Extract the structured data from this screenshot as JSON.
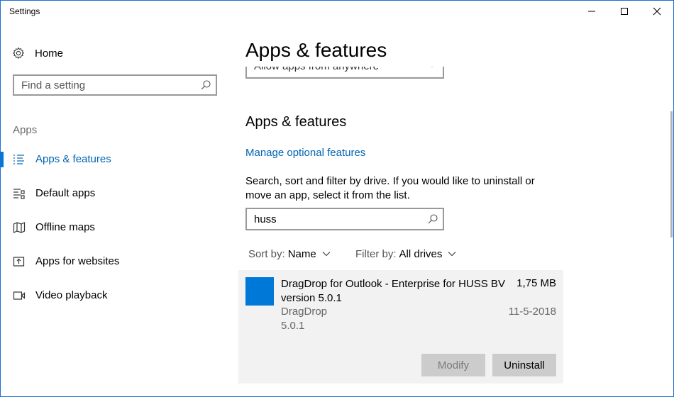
{
  "window": {
    "title": "Settings"
  },
  "sidebar": {
    "home_label": "Home",
    "search_placeholder": "Find a setting",
    "section_label": "Apps",
    "items": [
      {
        "label": "Apps & features",
        "icon": "list-icon",
        "active": true
      },
      {
        "label": "Default apps",
        "icon": "default-apps-icon",
        "active": false
      },
      {
        "label": "Offline maps",
        "icon": "map-icon",
        "active": false
      },
      {
        "label": "Apps for websites",
        "icon": "open-in-app-icon",
        "active": false
      },
      {
        "label": "Video playback",
        "icon": "video-icon",
        "active": false
      }
    ]
  },
  "main": {
    "page_title": "Apps & features",
    "install_source_value": "Allow apps from anywhere",
    "section_title": "Apps & features",
    "manage_link": "Manage optional features",
    "description": "Search, sort and filter by drive. If you would like to uninstall or move an app, select it from the list.",
    "search_value": "huss",
    "sort_key": "Sort by:",
    "sort_value": "Name",
    "filter_key": "Filter by:",
    "filter_value": "All drives",
    "app": {
      "name": "DragDrop for Outlook - Enterprise for HUSS BV version 5.0.1",
      "size": "1,75 MB",
      "publisher": "DragDrop",
      "date": "11-5-2018",
      "version": "5.0.1",
      "modify_label": "Modify",
      "uninstall_label": "Uninstall"
    }
  },
  "colors": {
    "accent": "#0078d7",
    "link": "#0063b1",
    "card_bg": "#f2f2f2",
    "button_bg": "#cccccc"
  }
}
